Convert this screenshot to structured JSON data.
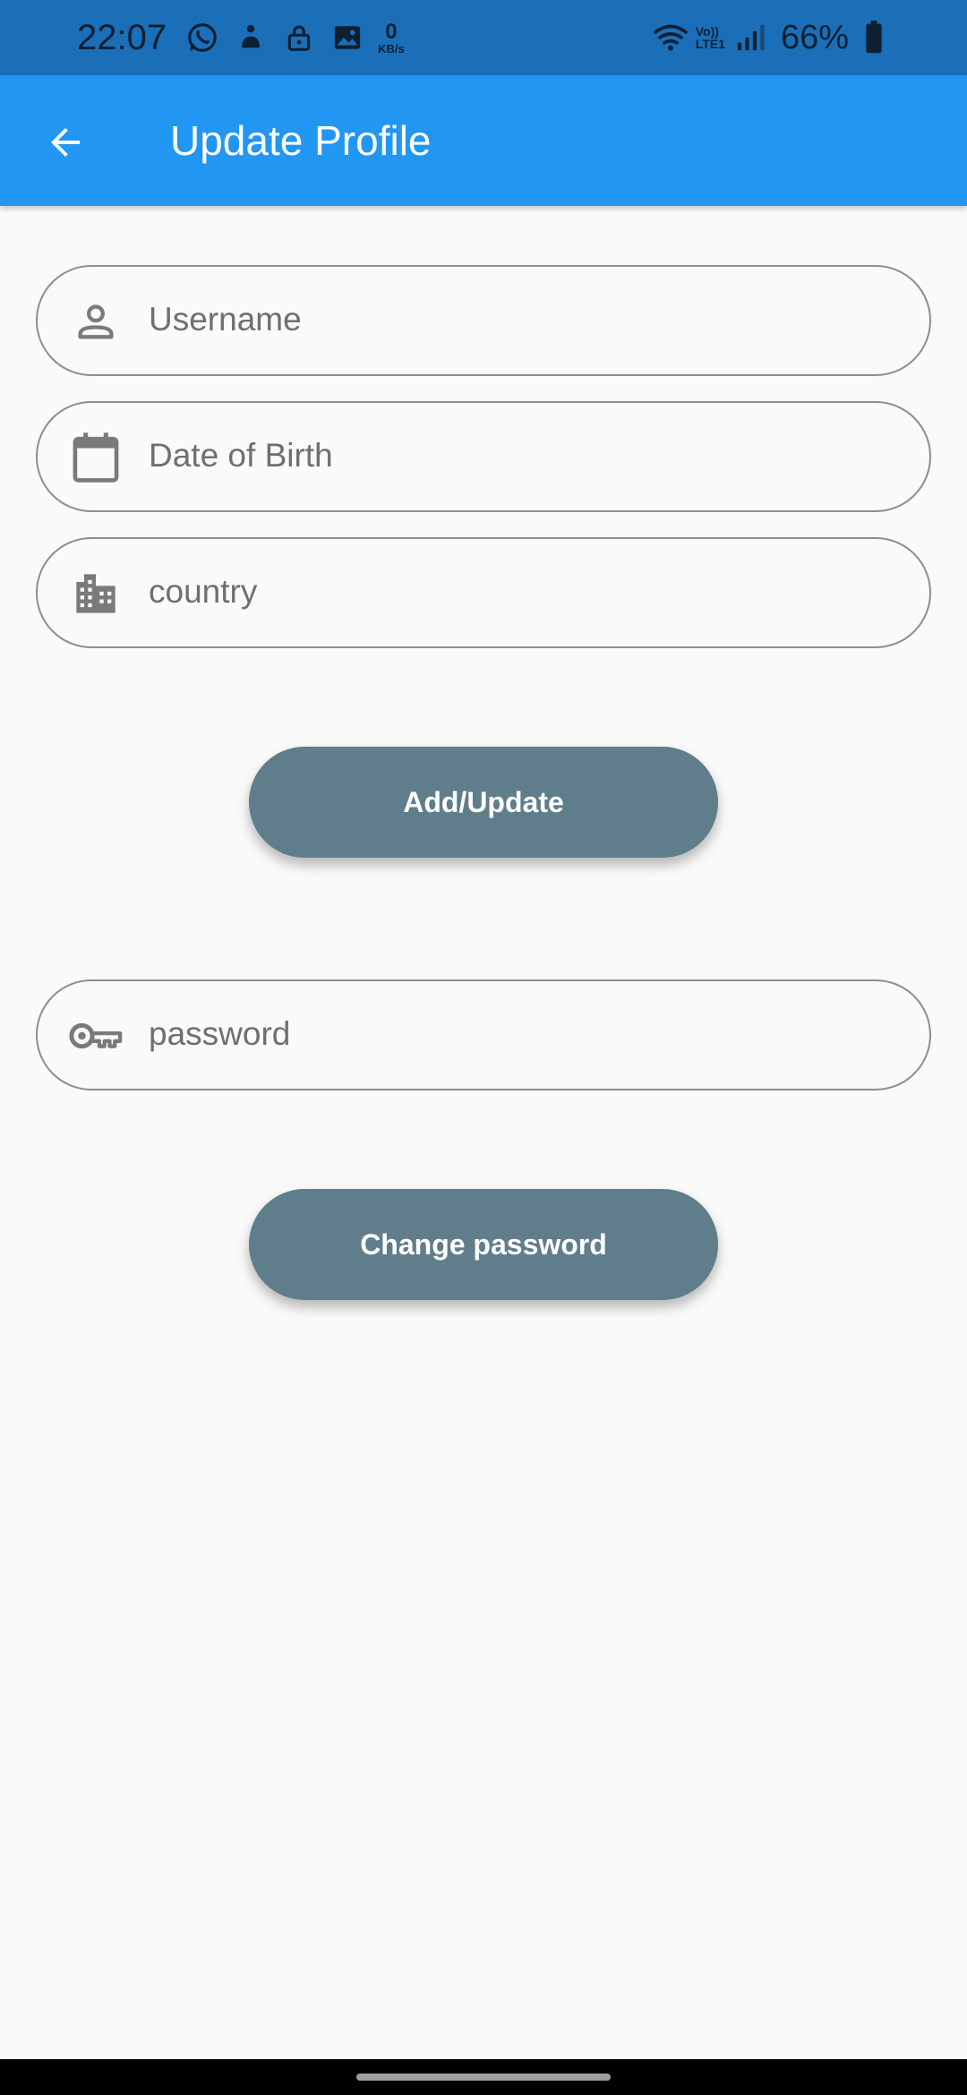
{
  "status_bar": {
    "time": "22:07",
    "data_speed_value": "0",
    "data_speed_unit": "KB/s",
    "volte_top": "Vo))",
    "volte_bottom": "LTE1",
    "battery_percent": "66%",
    "icons": [
      "whatsapp-icon",
      "notification-icon",
      "lock-icon",
      "image-icon",
      "wifi-icon",
      "signal-icon",
      "battery-icon"
    ]
  },
  "app_bar": {
    "title": "Update Profile",
    "back_icon": "arrow-back-icon",
    "color": "#2196f3"
  },
  "form": {
    "username_placeholder": "Username",
    "dob_placeholder": "Date of Birth",
    "country_placeholder": "country",
    "password_placeholder": "password",
    "icons": [
      "person-icon",
      "calendar-icon",
      "building-icon",
      "key-icon"
    ]
  },
  "buttons": {
    "add_update_label": "Add/Update",
    "change_password_label": "Change password",
    "color": "#607d8b"
  }
}
